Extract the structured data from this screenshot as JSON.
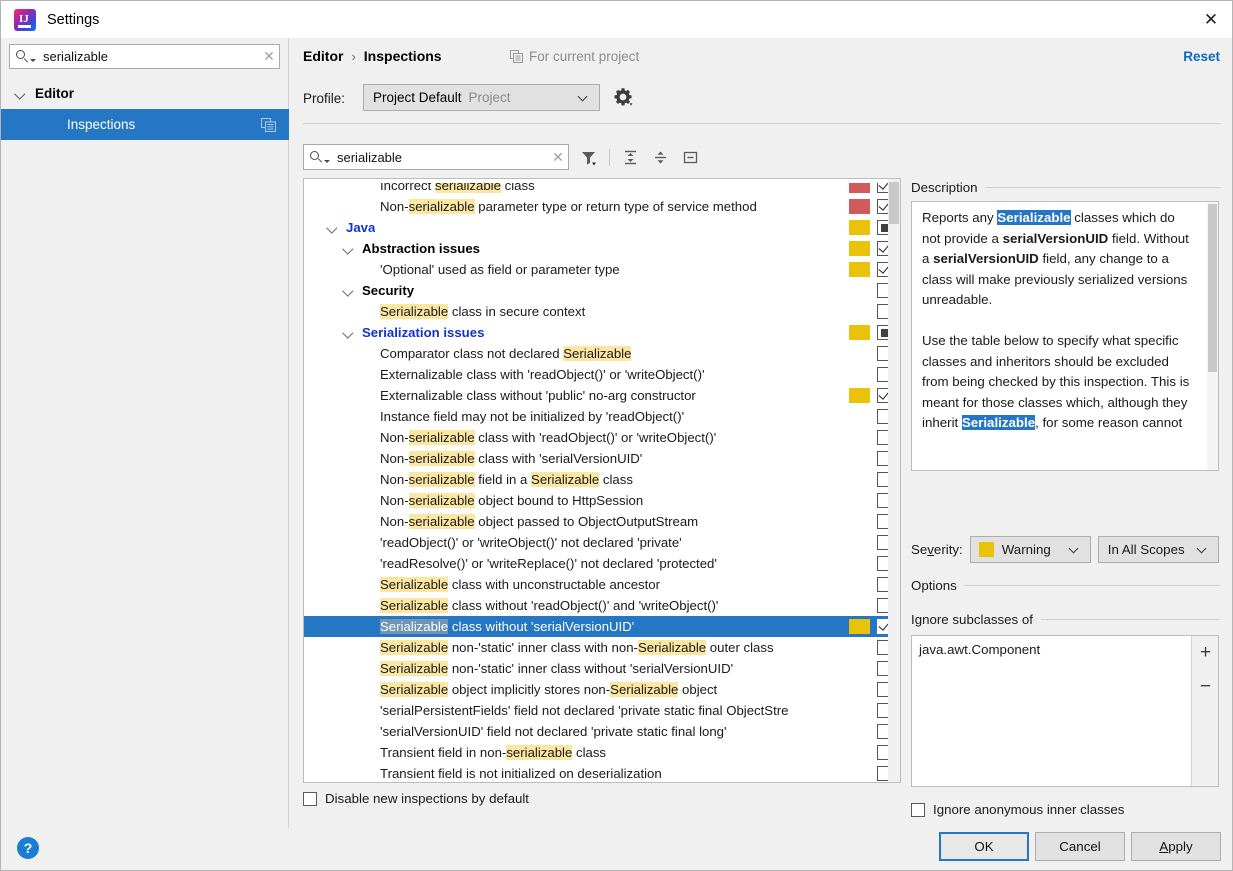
{
  "window": {
    "title": "Settings",
    "close_icon": "close-icon",
    "logo_icon": "intellij-idea-logo"
  },
  "sidebar": {
    "search": {
      "value": "serializable",
      "placeholder": "",
      "icon": "search-icon",
      "clear_icon": "clear-icon"
    },
    "items": [
      {
        "label": "Editor",
        "expanded": true,
        "selected": false,
        "depth": 0
      },
      {
        "label": "Inspections",
        "expanded": false,
        "selected": true,
        "depth": 1,
        "trailing_icon": "copy-icon"
      }
    ]
  },
  "header": {
    "breadcrumb": [
      "Editor",
      "Inspections"
    ],
    "separator": "›",
    "for_current_project": "For current project",
    "for_current_project_icon": "copy-icon",
    "reset_label": "Reset",
    "profile_label": "Profile:",
    "profile_name": "Project Default",
    "profile_scope": "Project",
    "gear_icon": "gear-icon"
  },
  "toolbar": {
    "search": {
      "value": "serializable",
      "icon": "search-icon",
      "clear_icon": "clear-icon"
    },
    "buttons": [
      {
        "name": "filter-icon",
        "title": "Filter"
      },
      {
        "name": "expand-all-icon",
        "title": "Expand All"
      },
      {
        "name": "collapse-all-icon",
        "title": "Collapse All"
      },
      {
        "name": "collapse-box-icon",
        "title": "Collapse"
      }
    ]
  },
  "colors": {
    "selection_blue": "#2577c4",
    "severity_warning": "#ebc20a",
    "severity_error": "#d15b5b",
    "highlight_yellow": "#fbe6a2",
    "link_blue": "#0969c3",
    "group_blue": "#1333cc"
  },
  "inspections": [
    {
      "depth": 3,
      "parts": [
        {
          "t": "Incorrect ",
          "h": false
        },
        {
          "t": "serializable",
          "h": true
        },
        {
          "t": " class",
          "h": false
        }
      ],
      "severity": "error",
      "check": "checked",
      "group": false,
      "selected": false,
      "clipped_top": true
    },
    {
      "depth": 3,
      "parts": [
        {
          "t": "Non-",
          "h": false
        },
        {
          "t": "serializable",
          "h": true
        },
        {
          "t": " parameter type or return type of service method",
          "h": false
        }
      ],
      "severity": "error",
      "check": "checked",
      "group": false,
      "selected": false
    },
    {
      "depth": 0,
      "parts": [
        {
          "t": "Java",
          "h": false
        }
      ],
      "severity": "warning",
      "check": "partial",
      "group": "blue",
      "arrow": true,
      "selected": false
    },
    {
      "depth": 1,
      "parts": [
        {
          "t": "Abstraction issues",
          "h": false
        }
      ],
      "severity": "warning",
      "check": "checked",
      "group": "black",
      "arrow": true,
      "selected": false
    },
    {
      "depth": 3,
      "parts": [
        {
          "t": "'Optional' used as field or parameter type",
          "h": false
        }
      ],
      "severity": "warning",
      "check": "checked",
      "group": false,
      "selected": false
    },
    {
      "depth": 1,
      "parts": [
        {
          "t": "Security",
          "h": false
        }
      ],
      "severity": "none",
      "check": "empty",
      "group": "black",
      "arrow": true,
      "selected": false
    },
    {
      "depth": 3,
      "parts": [
        {
          "t": "Serializable",
          "h": true
        },
        {
          "t": " class in secure context",
          "h": false
        }
      ],
      "severity": "none",
      "check": "empty",
      "group": false,
      "selected": false
    },
    {
      "depth": 1,
      "parts": [
        {
          "t": "Serialization issues",
          "h": false
        }
      ],
      "severity": "warning",
      "check": "partial",
      "group": "blue",
      "arrow": true,
      "selected": false
    },
    {
      "depth": 3,
      "parts": [
        {
          "t": "Comparator class not declared ",
          "h": false
        },
        {
          "t": "Serializable",
          "h": true
        }
      ],
      "severity": "none",
      "check": "empty",
      "group": false,
      "selected": false
    },
    {
      "depth": 3,
      "parts": [
        {
          "t": "Externalizable class with 'readObject()' or 'writeObject()'",
          "h": false
        }
      ],
      "severity": "none",
      "check": "empty",
      "group": false,
      "selected": false
    },
    {
      "depth": 3,
      "parts": [
        {
          "t": "Externalizable class without 'public' no-arg constructor",
          "h": false
        }
      ],
      "severity": "warning",
      "check": "checked",
      "group": false,
      "selected": false
    },
    {
      "depth": 3,
      "parts": [
        {
          "t": "Instance field may not be initialized by 'readObject()'",
          "h": false
        }
      ],
      "severity": "none",
      "check": "empty",
      "group": false,
      "selected": false
    },
    {
      "depth": 3,
      "parts": [
        {
          "t": "Non-",
          "h": false
        },
        {
          "t": "serializable",
          "h": true
        },
        {
          "t": " class with 'readObject()' or 'writeObject()'",
          "h": false
        }
      ],
      "severity": "none",
      "check": "empty",
      "group": false,
      "selected": false
    },
    {
      "depth": 3,
      "parts": [
        {
          "t": "Non-",
          "h": false
        },
        {
          "t": "serializable",
          "h": true
        },
        {
          "t": " class with 'serialVersionUID'",
          "h": false
        }
      ],
      "severity": "none",
      "check": "empty",
      "group": false,
      "selected": false
    },
    {
      "depth": 3,
      "parts": [
        {
          "t": "Non-",
          "h": false
        },
        {
          "t": "serializable",
          "h": true
        },
        {
          "t": " field in a ",
          "h": false
        },
        {
          "t": "Serializable",
          "h": true
        },
        {
          "t": " class",
          "h": false
        }
      ],
      "severity": "none",
      "check": "empty",
      "group": false,
      "selected": false
    },
    {
      "depth": 3,
      "parts": [
        {
          "t": "Non-",
          "h": false
        },
        {
          "t": "serializable",
          "h": true
        },
        {
          "t": " object bound to HttpSession",
          "h": false
        }
      ],
      "severity": "none",
      "check": "empty",
      "group": false,
      "selected": false
    },
    {
      "depth": 3,
      "parts": [
        {
          "t": "Non-",
          "h": false
        },
        {
          "t": "serializable",
          "h": true
        },
        {
          "t": " object passed to ObjectOutputStream",
          "h": false
        }
      ],
      "severity": "none",
      "check": "empty",
      "group": false,
      "selected": false
    },
    {
      "depth": 3,
      "parts": [
        {
          "t": "'readObject()' or 'writeObject()' not declared 'private'",
          "h": false
        }
      ],
      "severity": "none",
      "check": "empty",
      "group": false,
      "selected": false
    },
    {
      "depth": 3,
      "parts": [
        {
          "t": "'readResolve()' or 'writeReplace()' not declared 'protected'",
          "h": false
        }
      ],
      "severity": "none",
      "check": "empty",
      "group": false,
      "selected": false
    },
    {
      "depth": 3,
      "parts": [
        {
          "t": "Serializable",
          "h": true
        },
        {
          "t": " class with unconstructable ancestor",
          "h": false
        }
      ],
      "severity": "none",
      "check": "empty",
      "group": false,
      "selected": false
    },
    {
      "depth": 3,
      "parts": [
        {
          "t": "Serializable",
          "h": true
        },
        {
          "t": " class without 'readObject()' and 'writeObject()'",
          "h": false
        }
      ],
      "severity": "none",
      "check": "empty",
      "group": false,
      "selected": false
    },
    {
      "depth": 3,
      "parts": [
        {
          "t": "Serializable",
          "h": true
        },
        {
          "t": " class without 'serialVersionUID'",
          "h": false
        }
      ],
      "severity": "warning",
      "check": "checked",
      "group": false,
      "selected": true
    },
    {
      "depth": 3,
      "parts": [
        {
          "t": "Serializable",
          "h": true
        },
        {
          "t": " non-'static' inner class with non-",
          "h": false
        },
        {
          "t": "Serializable",
          "h": true
        },
        {
          "t": " outer class",
          "h": false
        }
      ],
      "severity": "none",
      "check": "empty",
      "group": false,
      "selected": false
    },
    {
      "depth": 3,
      "parts": [
        {
          "t": "Serializable",
          "h": true
        },
        {
          "t": " non-'static' inner class without 'serialVersionUID'",
          "h": false
        }
      ],
      "severity": "none",
      "check": "empty",
      "group": false,
      "selected": false
    },
    {
      "depth": 3,
      "parts": [
        {
          "t": "Serializable",
          "h": true
        },
        {
          "t": " object implicitly stores non-",
          "h": false
        },
        {
          "t": "Serializable",
          "h": true
        },
        {
          "t": " object",
          "h": false
        }
      ],
      "severity": "none",
      "check": "empty",
      "group": false,
      "selected": false
    },
    {
      "depth": 3,
      "parts": [
        {
          "t": "'serialPersistentFields' field not declared 'private static final ObjectStre",
          "h": false
        }
      ],
      "severity": "none",
      "check": "empty",
      "group": false,
      "selected": false,
      "clipped_right": true
    },
    {
      "depth": 3,
      "parts": [
        {
          "t": "'serialVersionUID' field not declared 'private static final long'",
          "h": false
        }
      ],
      "severity": "none",
      "check": "empty",
      "group": false,
      "selected": false
    },
    {
      "depth": 3,
      "parts": [
        {
          "t": "Transient field in non-",
          "h": false
        },
        {
          "t": "serializable",
          "h": true
        },
        {
          "t": " class",
          "h": false
        }
      ],
      "severity": "none",
      "check": "empty",
      "group": false,
      "selected": false
    },
    {
      "depth": 3,
      "parts": [
        {
          "t": "Transient field is not initialized on deserialization",
          "h": false
        }
      ],
      "severity": "none",
      "check": "empty",
      "group": false,
      "selected": false
    }
  ],
  "disable_new_inspections": {
    "label": "Disable new inspections by default",
    "checked": false
  },
  "description": {
    "title": "Description",
    "paragraph1_parts": [
      {
        "t": "Reports any ",
        "hl": false
      },
      {
        "t": "Serializable",
        "hl": true
      },
      {
        "t": " classes which do not provide a ",
        "hl": false
      },
      {
        "t": "serialVersionUID",
        "bold": true
      },
      {
        "t": " field. Without a ",
        "hl": false
      },
      {
        "t": "serialVersionUID",
        "bold": true
      },
      {
        "t": " field, any change to a class will make previously serialized versions unreadable.",
        "hl": false
      }
    ],
    "paragraph2": "Use the table below to specify what specific classes and inheritors should be excluded from being checked by this inspection. This is meant for those classes which, although they inherit"
  },
  "severity": {
    "label": "Severity:",
    "label_mnemonic_index": 3,
    "value": "Warning",
    "swatch_color": "#ebc20a",
    "scope_value": "In All Scopes"
  },
  "options": {
    "title": "Options",
    "ignore_subclasses_title": "Ignore subclasses of",
    "ignore_list": [
      "java.awt.Component"
    ],
    "add_button": "+",
    "remove_button": "−",
    "ignore_anonymous": {
      "label": "Ignore anonymous inner classes",
      "checked": false
    }
  },
  "footer": {
    "help_icon": "help-icon",
    "ok_label": "OK",
    "cancel_label": "Cancel",
    "apply_label": "Apply"
  }
}
